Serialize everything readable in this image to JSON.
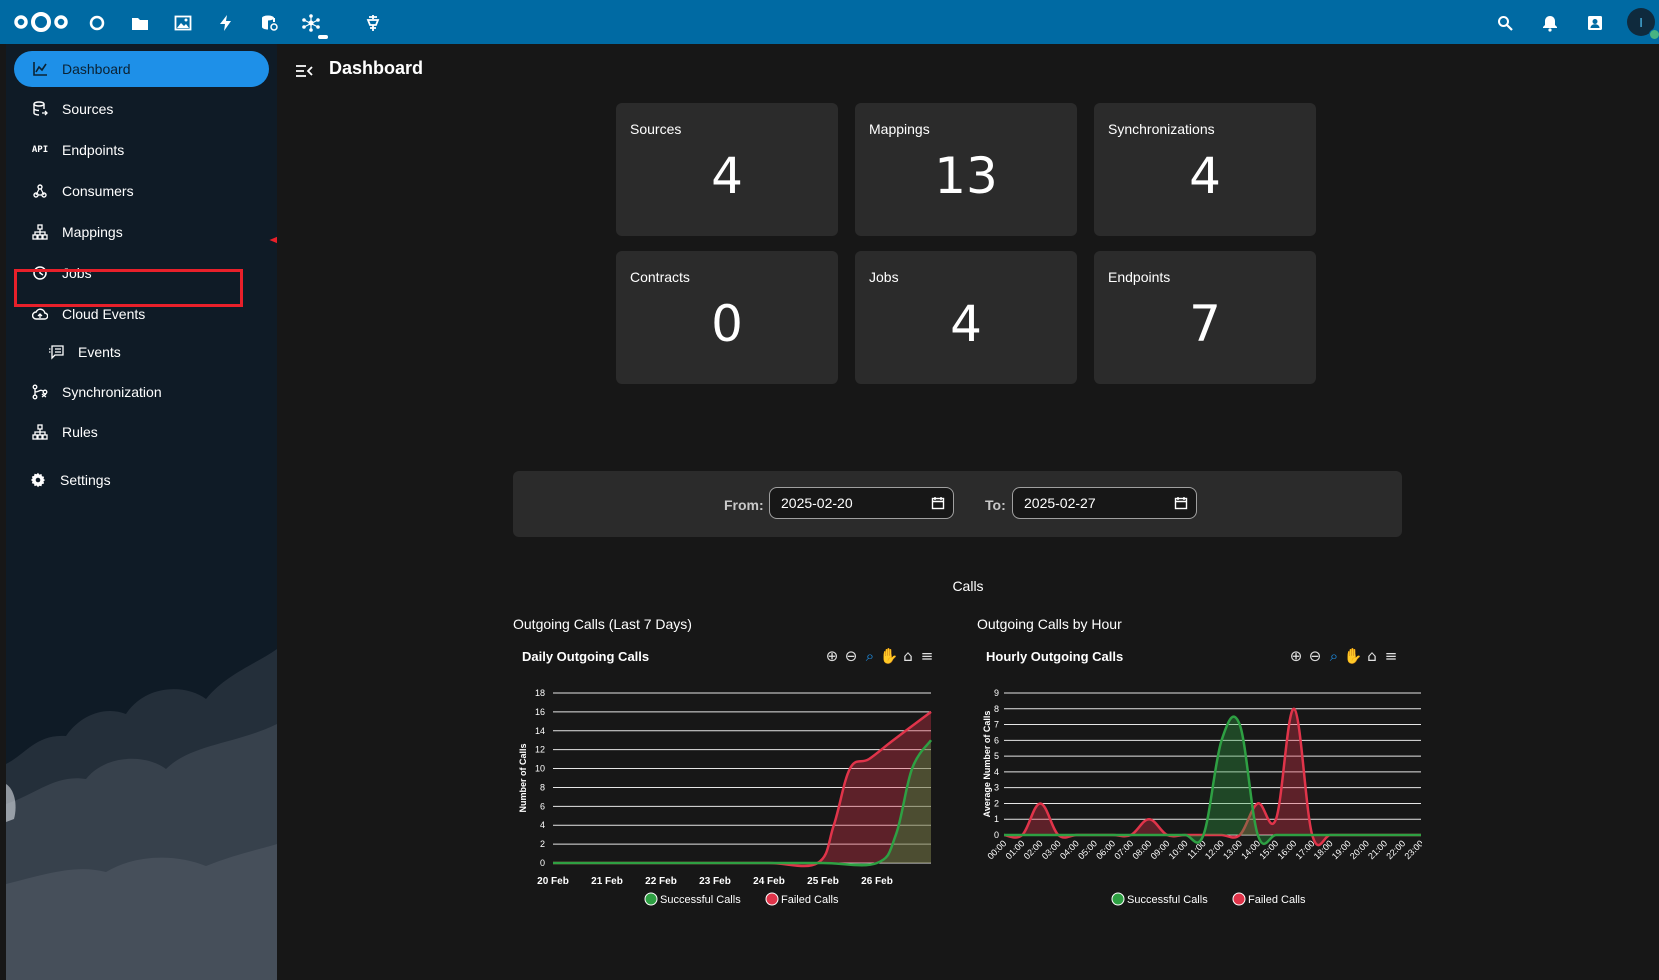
{
  "topbar": {
    "apps": [
      {
        "name": "dashboard-app",
        "icon": "circle-icon"
      },
      {
        "name": "files-app",
        "icon": "folder-icon"
      },
      {
        "name": "photos-app",
        "icon": "image-icon"
      },
      {
        "name": "activity-app",
        "icon": "bolt-icon"
      },
      {
        "name": "openregister-app",
        "icon": "database-icon"
      },
      {
        "name": "openconnector-app",
        "icon": "connector-icon"
      },
      {
        "name": "other-app",
        "icon": "plug-icon"
      }
    ],
    "avatar_initial": "I",
    "accent": "#006aa3"
  },
  "sidebar": {
    "items": [
      {
        "label": "Dashboard",
        "icon": "chart-icon",
        "active": true
      },
      {
        "label": "Sources",
        "icon": "database-icon"
      },
      {
        "label": "Endpoints",
        "icon": "api-icon"
      },
      {
        "label": "Consumers",
        "icon": "webhook-icon"
      },
      {
        "label": "Mappings",
        "icon": "sitemap-icon"
      },
      {
        "label": "Jobs",
        "icon": "timer-icon"
      },
      {
        "label": "Cloud Events",
        "icon": "cloud-icon"
      },
      {
        "label": "Events",
        "icon": "message-list-icon"
      },
      {
        "label": "Synchronization",
        "icon": "sync-icon"
      },
      {
        "label": "Rules",
        "icon": "sitemap-icon"
      },
      {
        "label": "Settings",
        "icon": "gear-icon"
      }
    ],
    "api_icon_text": "API",
    "highlight_color": "#e8202a"
  },
  "main": {
    "title": "Dashboard",
    "cards": [
      {
        "label": "Sources",
        "value": "4"
      },
      {
        "label": "Mappings",
        "value": "13"
      },
      {
        "label": "Synchronizations",
        "value": "4"
      },
      {
        "label": "Contracts",
        "value": "0"
      },
      {
        "label": "Jobs",
        "value": "4"
      },
      {
        "label": "Endpoints",
        "value": "7"
      }
    ],
    "filter": {
      "from_label": "From:",
      "from_value": "2025-02-20",
      "to_label": "To:",
      "to_value": "2025-02-27"
    },
    "calls_title": "Calls"
  },
  "chart_data": [
    {
      "type": "area",
      "caption": "Outgoing Calls (Last 7 Days)",
      "title": "Daily Outgoing Calls",
      "ylabel": "Number of Calls",
      "ylim": [
        0,
        18
      ],
      "yticks": [
        0,
        2,
        4,
        6,
        8,
        10,
        12,
        14,
        16,
        18
      ],
      "x_labels": [
        "20 Feb",
        "21 Feb",
        "22 Feb",
        "23 Feb",
        "24 Feb",
        "25 Feb",
        "26 Feb"
      ],
      "series": [
        {
          "name": "Successful Calls",
          "color": "#2ea043",
          "points": [
            [
              0,
              0
            ],
            [
              1,
              0
            ],
            [
              2,
              0
            ],
            [
              3,
              0
            ],
            [
              4,
              0
            ],
            [
              5,
              0
            ],
            [
              6,
              0
            ],
            [
              6.35,
              3
            ],
            [
              6.65,
              10
            ],
            [
              7,
              13
            ]
          ]
        },
        {
          "name": "Failed Calls",
          "color": "#e0344a",
          "points": [
            [
              0,
              0
            ],
            [
              1,
              0
            ],
            [
              2,
              0
            ],
            [
              3,
              0
            ],
            [
              4,
              0
            ],
            [
              4.9,
              0
            ],
            [
              5.2,
              4
            ],
            [
              5.5,
              10
            ],
            [
              5.85,
              11
            ],
            [
              6.3,
              13
            ],
            [
              7,
              16
            ]
          ]
        }
      ],
      "grid": true,
      "legend": "bottom"
    },
    {
      "type": "area",
      "caption": "Outgoing Calls by Hour",
      "title": "Hourly Outgoing Calls",
      "ylabel": "Average Number of Calls",
      "ylim": [
        0,
        9
      ],
      "yticks": [
        0,
        1,
        2,
        3,
        4,
        5,
        6,
        7,
        8,
        9
      ],
      "x_labels": [
        "00:00",
        "01:00",
        "02:00",
        "03:00",
        "04:00",
        "05:00",
        "06:00",
        "07:00",
        "08:00",
        "09:00",
        "10:00",
        "11:00",
        "12:00",
        "13:00",
        "14:00",
        "15:00",
        "16:00",
        "17:00",
        "18:00",
        "19:00",
        "20:00",
        "21:00",
        "22:00",
        "23:00"
      ],
      "series": [
        {
          "name": "Successful Calls",
          "color": "#2ea043",
          "values": [
            0,
            0,
            0,
            0,
            0,
            0,
            0,
            0,
            0,
            0,
            0,
            0,
            6,
            7,
            0,
            0,
            0,
            0,
            0,
            0,
            0,
            0,
            0,
            0
          ]
        },
        {
          "name": "Failed Calls",
          "color": "#e0344a",
          "values": [
            0,
            0,
            2,
            0,
            0,
            0,
            0,
            0,
            1,
            0,
            0,
            0,
            0,
            0,
            2,
            1,
            8,
            0,
            0,
            0,
            0,
            0,
            0,
            0
          ]
        }
      ],
      "grid": true,
      "legend": "bottom"
    }
  ]
}
